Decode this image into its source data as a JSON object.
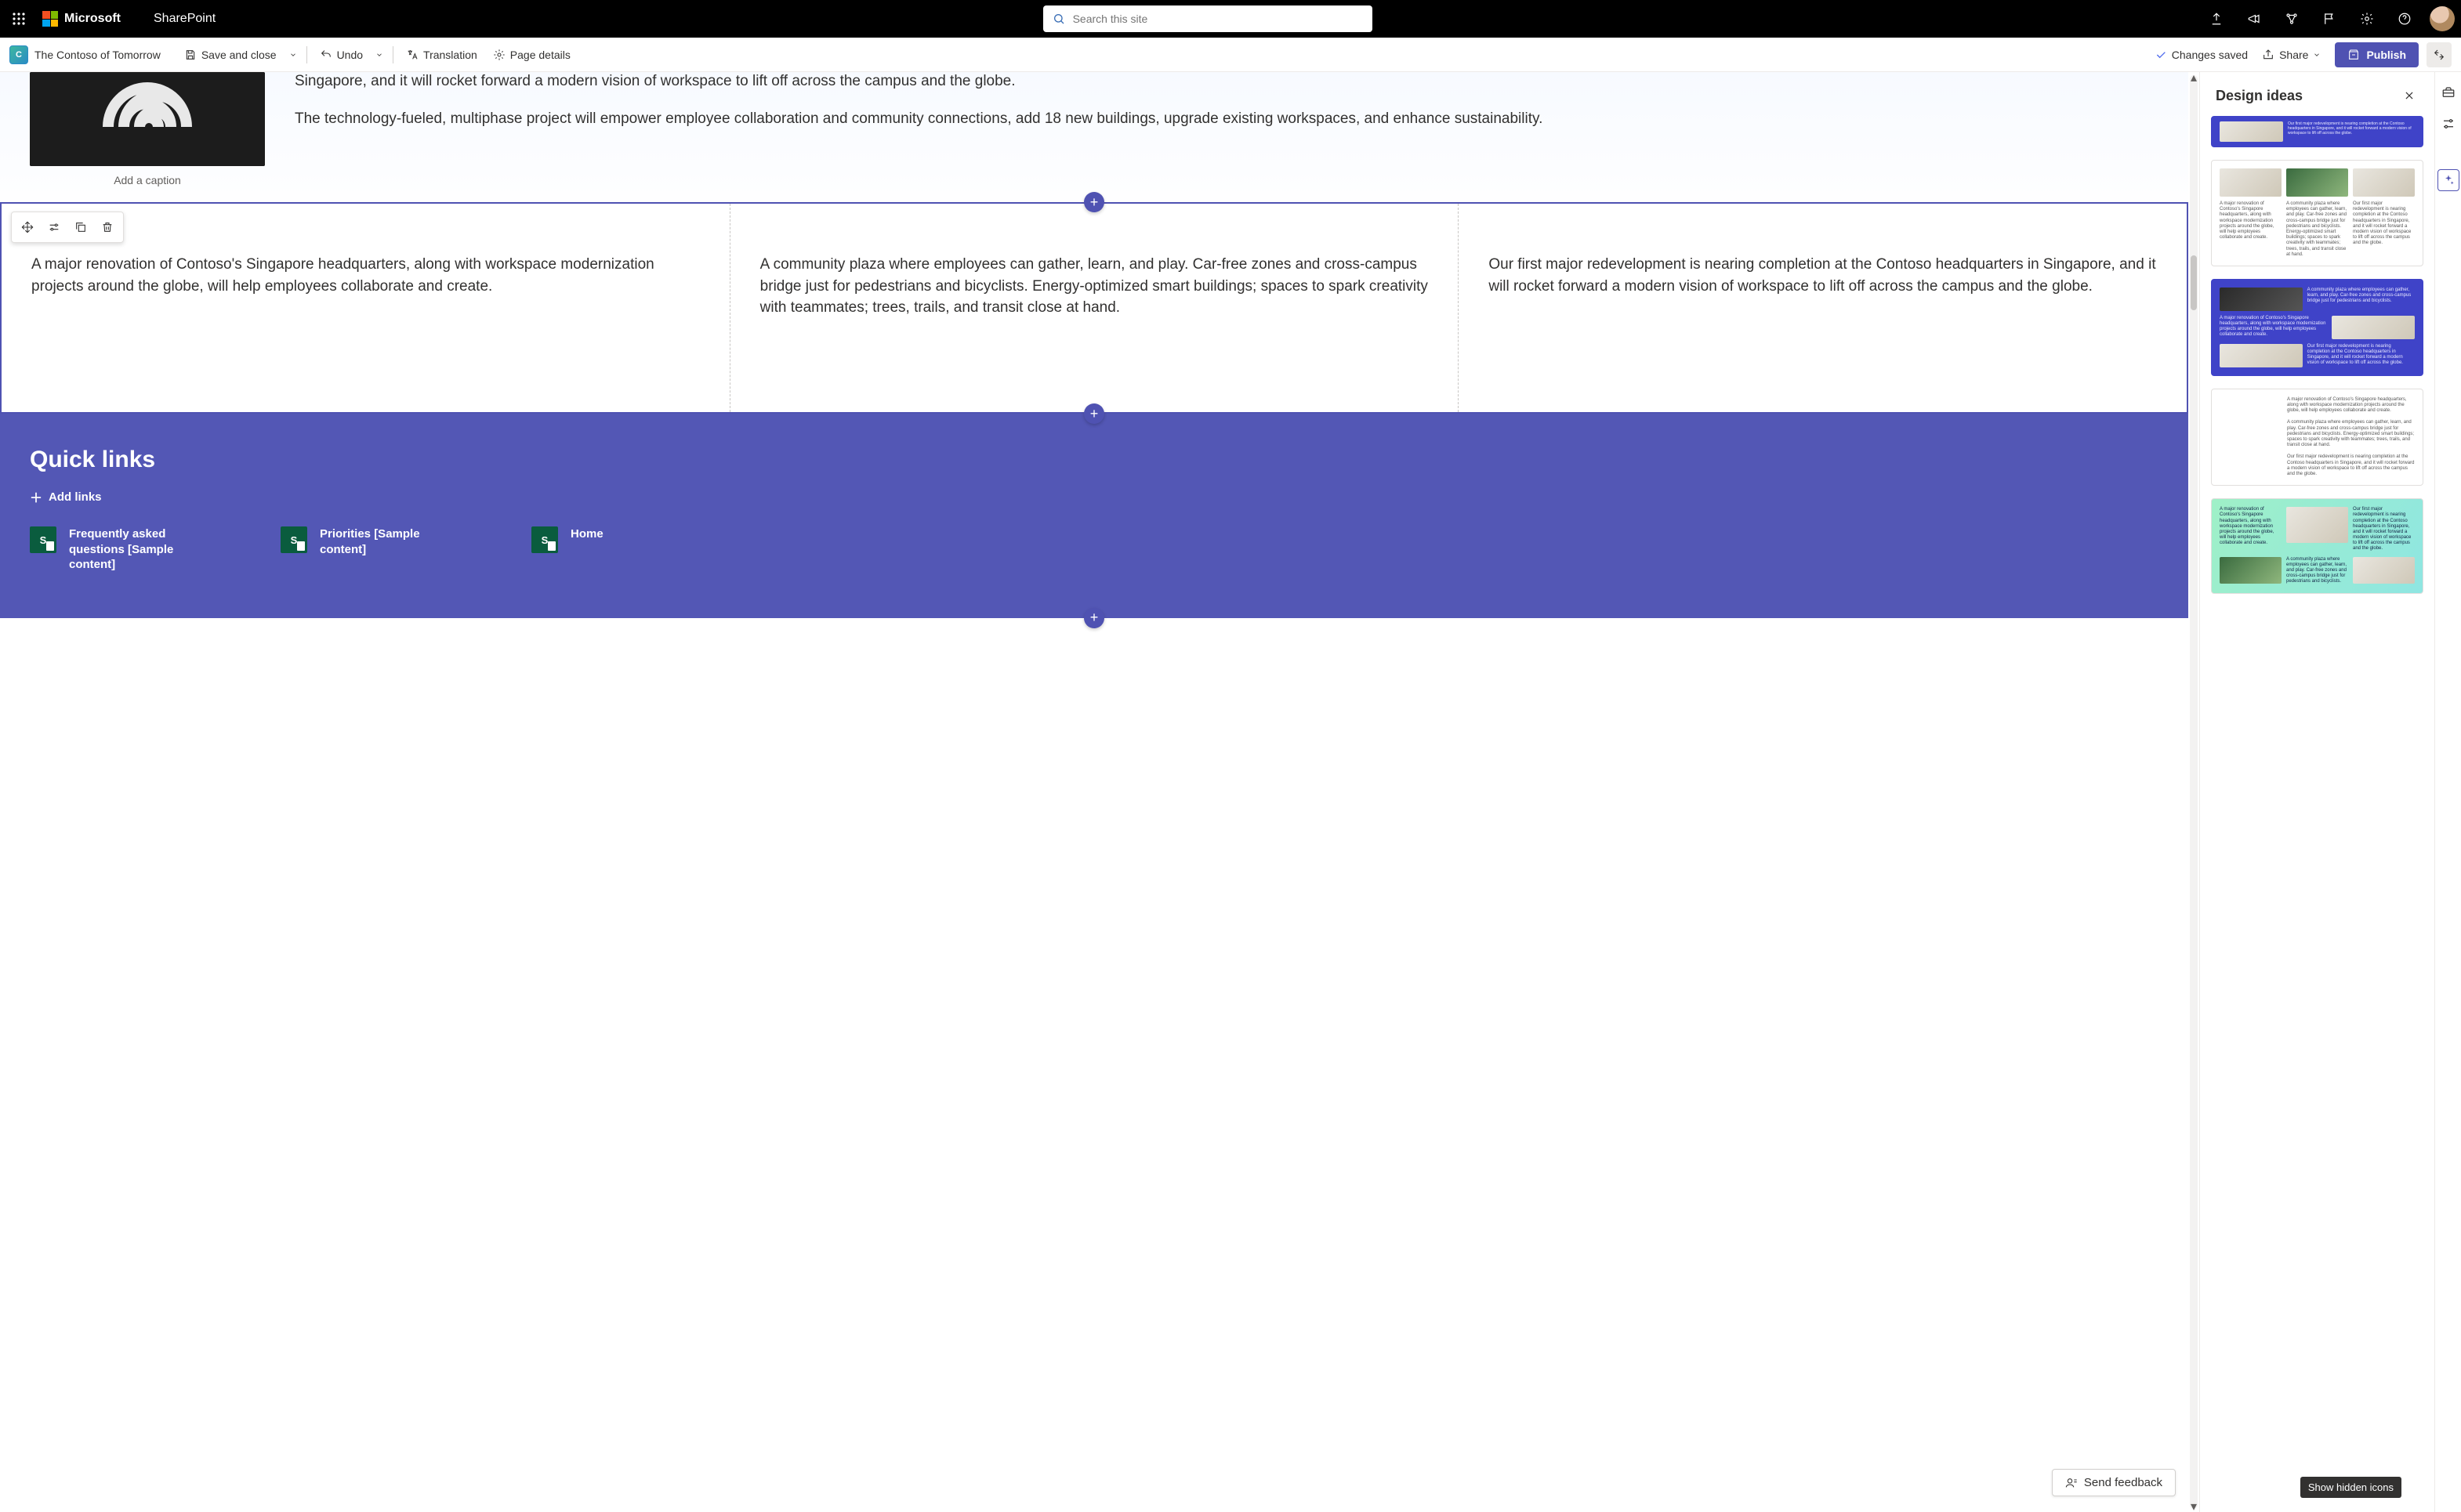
{
  "header": {
    "brand": "Microsoft",
    "app": "SharePoint",
    "search_placeholder": "Search this site"
  },
  "cmdbar": {
    "site_name": "The Contoso of Tomorrow",
    "save_close": "Save and close",
    "undo": "Undo",
    "translation": "Translation",
    "page_details": "Page details",
    "saved_status": "Changes saved",
    "share": "Share",
    "publish": "Publish"
  },
  "intro": {
    "caption_placeholder": "Add a caption",
    "para1_trunc": "Singapore, and it will rocket forward a modern vision of workspace to lift off across the campus and the globe.",
    "para2": "The technology-fueled, multiphase project will empower employee collaboration and community connections, add 18 new buildings, upgrade existing workspaces, and enhance sustainability."
  },
  "columns": {
    "c1": "A major renovation of Contoso's Singapore headquarters, along with workspace modernization projects around the globe, will help employees collaborate and create.",
    "c2": "A community plaza where employees can gather, learn, and play. Car-free zones and cross-campus bridge just for pedestrians and bicyclists. Energy-optimized smart buildings; spaces to spark creativity with teammates; trees, trails, and transit close at hand.",
    "c3": "Our first major redevelopment is nearing completion at the Contoso headquarters in Singapore, and it will rocket forward a modern vision of workspace to lift off across the campus and the globe."
  },
  "quicklinks": {
    "title": "Quick links",
    "add_label": "Add links",
    "items": [
      {
        "label": "Frequently asked questions [Sample content]"
      },
      {
        "label": "Priorities [Sample content]"
      },
      {
        "label": "Home"
      }
    ]
  },
  "feedback": {
    "label": "Send feedback"
  },
  "design": {
    "title": "Design ideas",
    "tooltip": "Show hidden icons"
  }
}
